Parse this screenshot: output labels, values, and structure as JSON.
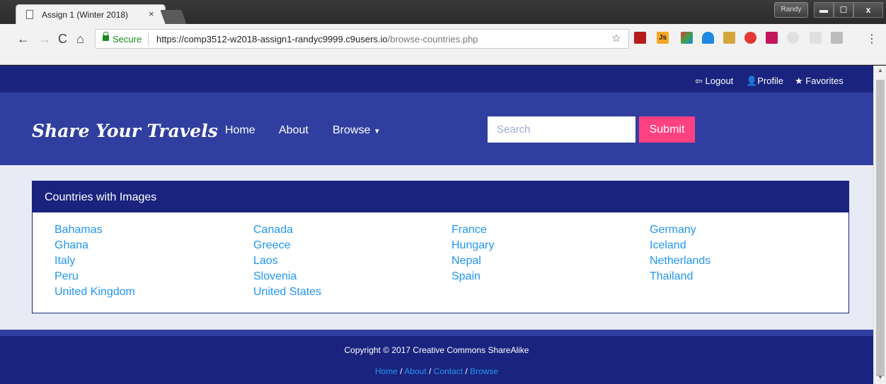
{
  "browser": {
    "tab_title": "Assign 1 (Winter 2018)",
    "tab_close": "×",
    "user": "Randy",
    "minimize": "▬",
    "maximize": "☐",
    "close": "x",
    "back": "←",
    "forward": "→",
    "reload": "C",
    "home": "⌂",
    "secure_label": "Secure",
    "url_host": "https://comp3512-w2018-assign1-randyc9999.c9users.io",
    "url_path": "/browse-countries.php",
    "star": "☆",
    "menu": "⋮",
    "ext_js": "Js"
  },
  "site": {
    "top_links": {
      "logout": "Logout",
      "profile": "Profile",
      "favorites": "Favorites"
    },
    "brand": "Share Your Travels",
    "nav": {
      "home": "Home",
      "about": "About",
      "browse": "Browse"
    },
    "search": {
      "placeholder": "Search",
      "value": ""
    },
    "submit": "Submit"
  },
  "panel": {
    "title": "Countries with Images",
    "countries": [
      "Bahamas",
      "Canada",
      "France",
      "Germany",
      "Ghana",
      "Greece",
      "Hungary",
      "Iceland",
      "Italy",
      "Laos",
      "Nepal",
      "Netherlands",
      "Peru",
      "Slovenia",
      "Spain",
      "Thailand",
      "United Kingdom",
      "United States"
    ]
  },
  "footer": {
    "copyright": "Copyright © 2017 Creative Commons ShareAlike",
    "links": [
      "Home",
      "About",
      "Contact",
      "Browse"
    ],
    "separator": " / "
  },
  "colors": {
    "header_dark": "#1a237e",
    "header_main": "#303f9f",
    "accent_pink": "#ff4081",
    "link_blue": "#2196f3",
    "page_bg": "#e8eaf6"
  }
}
